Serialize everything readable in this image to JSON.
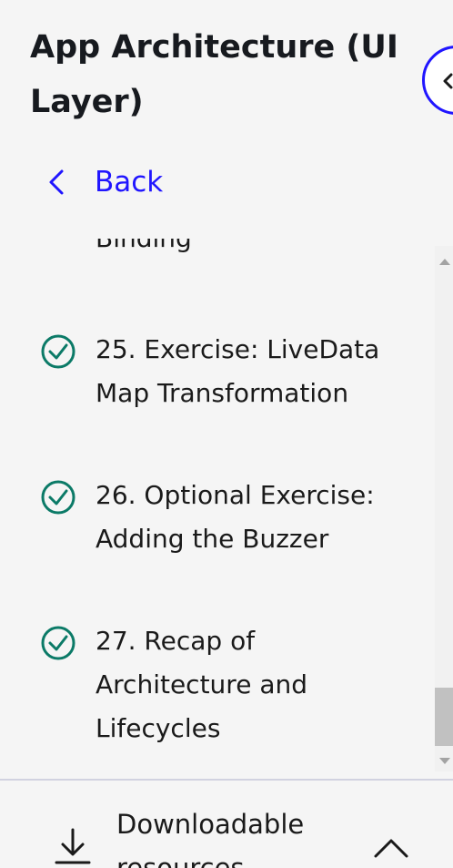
{
  "header": {
    "title": "App Architecture (UI Layer)",
    "back_label": "Back",
    "collapse_icon": "chevron-left-icon"
  },
  "lessons": {
    "items": [
      {
        "label": "Binding",
        "completed": true
      },
      {
        "label": "25. Exercise: LiveData Map Transformation",
        "completed": true
      },
      {
        "label": "26. Optional Exercise: Adding the Buzzer",
        "completed": true
      },
      {
        "label": "27. Recap of Architecture and Lifecycles",
        "completed": true
      }
    ]
  },
  "footer": {
    "downloads_label": "Downloadable resources",
    "download_icon": "download-icon",
    "toggle_icon": "chevron-up-icon"
  },
  "colors": {
    "accent": "#2015ff",
    "check": "#0b7a67",
    "background": "#f5f5f5",
    "divider": "#d1d2e0"
  }
}
